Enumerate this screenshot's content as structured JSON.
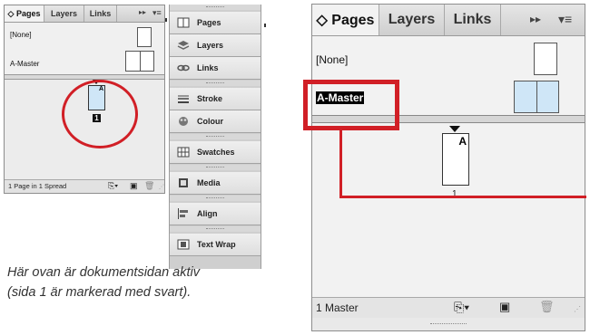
{
  "pages_panel": {
    "tabs": [
      {
        "label": "◇ Pages"
      },
      {
        "label": "Layers"
      },
      {
        "label": "Links"
      }
    ],
    "menu_glyph": "▸▸",
    "options_glyph": "▾≡",
    "masters": [
      {
        "label": "[None]"
      },
      {
        "label": "A-Master"
      }
    ],
    "page_master_letter": "A",
    "page_number": "1"
  },
  "small_panel": {
    "status": "1 Page in 1 Spread"
  },
  "large_panel": {
    "status": "1 Master"
  },
  "panel_list": {
    "items": [
      {
        "label": "Pages",
        "icon": "pages-icon"
      },
      {
        "label": "Layers",
        "icon": "layers-icon"
      },
      {
        "label": "Links",
        "icon": "links-icon"
      },
      {
        "label": "Stroke",
        "icon": "stroke-icon"
      },
      {
        "label": "Colour",
        "icon": "colour-icon"
      },
      {
        "label": "Swatches",
        "icon": "swatches-icon"
      },
      {
        "label": "Media",
        "icon": "media-icon"
      },
      {
        "label": "Align",
        "icon": "align-icon"
      },
      {
        "label": "Text Wrap",
        "icon": "text-wrap-icon"
      }
    ]
  },
  "caption": {
    "line1": "Här ovan är dokumentsidan aktiv",
    "line2": "(sida 1 är markerad med svart)."
  },
  "colors": {
    "highlight_red": "#d11f26",
    "selection_blue": "#cfe6f7"
  }
}
